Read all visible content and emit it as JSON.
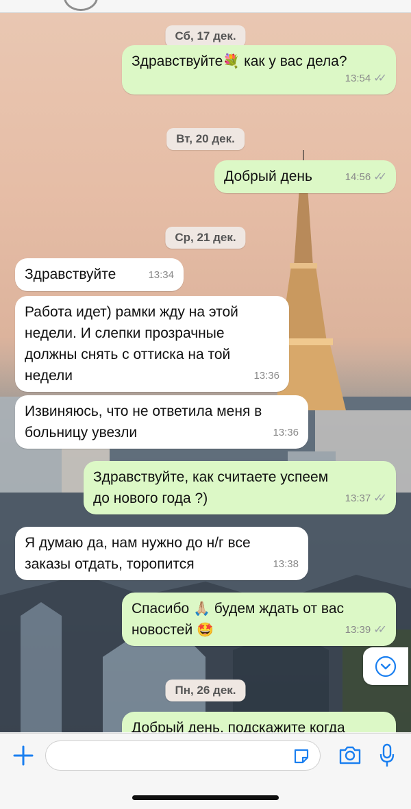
{
  "dates": [
    "Сб, 17 дек.",
    "Вт, 20 дек.",
    "Ср, 21 дек.",
    "Пн, 26 дек."
  ],
  "messages": [
    {
      "dir": "out",
      "lines": [
        "Здравствуйте",
        "как у вас дела?"
      ],
      "time": "13:54",
      "emoji": "💐"
    },
    {
      "dir": "out",
      "lines": [
        "Добрый день"
      ],
      "time": "14:56"
    },
    {
      "dir": "in",
      "lines": [
        "Здравствуйте"
      ],
      "time": "13:34"
    },
    {
      "dir": "in",
      "lines": [
        "Работа идет) рамки жду на этой",
        "недели. И слепки прозрачные",
        "должны снять с оттиска на той",
        "недели"
      ],
      "time": "13:36"
    },
    {
      "dir": "in",
      "lines": [
        "Извиняюсь, что не ответила меня в",
        "больницу увезли"
      ],
      "time": "13:36"
    },
    {
      "dir": "out",
      "lines": [
        "Здравствуйте, как считаете успеем",
        "до нового года ?)"
      ],
      "time": "13:37"
    },
    {
      "dir": "in",
      "lines": [
        "Я думаю да, нам нужно до н/г все",
        "заказы отдать, торопится"
      ],
      "time": "13:38"
    },
    {
      "dir": "out",
      "lines": [
        "Спасибо",
        "будем ждать от вас",
        "новостей"
      ],
      "time": "13:39",
      "emoji": "🙏🏼",
      "emoji2": "🤩"
    },
    {
      "dir": "out",
      "lines": [
        "Добрый день, подскажите когда"
      ],
      "time": ""
    }
  ],
  "icons": {
    "read_ticks": "✓✓",
    "add": "plus-icon",
    "sticker": "sticker-icon",
    "camera": "camera-icon",
    "mic": "microphone-icon",
    "scroll": "chevron-down-icon"
  },
  "input": {
    "placeholder": ""
  },
  "colors": {
    "outgoing": "#dcf8c6",
    "incoming": "#ffffff",
    "accent": "#1a7ff0"
  }
}
